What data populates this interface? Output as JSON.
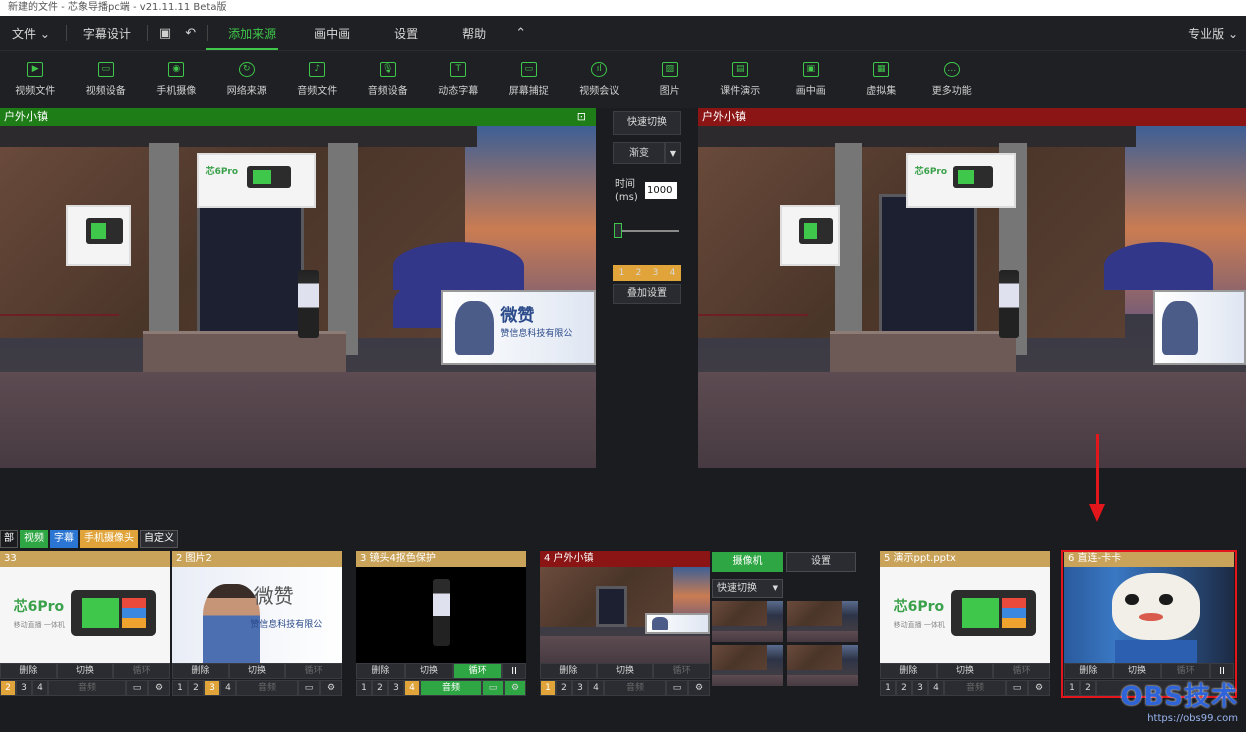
{
  "window": {
    "title": "新建的文件 - 芯象导播pc端 - v21.11.11 Beta版"
  },
  "menu": {
    "file": "文件",
    "file_arrow": "⌄",
    "subtitle_design": "字幕设计",
    "save_icon": "▣",
    "undo_icon": "↶",
    "add_source": "添加来源",
    "pip": "画中画",
    "settings": "设置",
    "help": "帮助",
    "collapse_icon": "⌃",
    "edition": "专业版",
    "edition_arrow": "⌄",
    "accent": "#3ec74a"
  },
  "toolbar": [
    {
      "label": "视频文件",
      "glyph": "▶"
    },
    {
      "label": "视频设备",
      "glyph": "▭"
    },
    {
      "label": "手机摄像",
      "glyph": "◉"
    },
    {
      "label": "网络来源",
      "glyph": "↻"
    },
    {
      "label": "音频文件",
      "glyph": "♪"
    },
    {
      "label": "音频设备",
      "glyph": "🎙"
    },
    {
      "label": "动态字幕",
      "glyph": "T"
    },
    {
      "label": "屏幕捕捉",
      "glyph": "▭"
    },
    {
      "label": "视频会议",
      "glyph": "ıl"
    },
    {
      "label": "图片",
      "glyph": "▨"
    },
    {
      "label": "课件演示",
      "glyph": "▤"
    },
    {
      "label": "画中画",
      "glyph": "▣"
    },
    {
      "label": "虚拟集",
      "glyph": "▦"
    },
    {
      "label": "更多功能",
      "glyph": "…"
    }
  ],
  "preview": {
    "title": "户外小镇",
    "expand_icon": "⊡",
    "color": "#1e7d16"
  },
  "program": {
    "title": "户外小镇",
    "color": "#8b1414"
  },
  "transition": {
    "quick_switch": "快速切换",
    "mode": "渐变",
    "mode_arrow": "▼",
    "time_label_1": "时间",
    "time_label_2": "(ms)",
    "time_value": "1000",
    "overlay_numbers": [
      "1",
      "2",
      "3",
      "4"
    ],
    "overlay_settings": "叠加设置"
  },
  "filter_tabs": [
    "部",
    "视频",
    "字幕",
    "手机摄像头",
    "自定义"
  ],
  "sources": [
    {
      "header": "33",
      "hdcolor": "#c9a35a",
      "type": "phone",
      "brand": "芯6Pro",
      "sub": "移动直播 一体机",
      "r1": [
        "删除",
        "切换",
        "循环"
      ],
      "nums": [
        "2",
        "3",
        "4"
      ],
      "sel": "2",
      "audio": "音频"
    },
    {
      "header": "2 图片2",
      "hdcolor": "#c9a35a",
      "type": "person",
      "brand": "微赞",
      "sub": "赞信息科技有限公",
      "r1": [
        "删除",
        "切换",
        "循环"
      ],
      "nums": [
        "1",
        "2",
        "3",
        "4"
      ],
      "sel": "3",
      "audio": "音频"
    },
    {
      "header": "3 镜头4抠色保护",
      "hdcolor": "#c9a35a",
      "type": "black",
      "r1": [
        "删除",
        "切换",
        "循环",
        "II"
      ],
      "nums": [
        "1",
        "2",
        "3",
        "4"
      ],
      "sel": "4",
      "audio": "音频"
    },
    {
      "header": "4 户外小镇",
      "hdcolor": "#8b1414",
      "type": "scene",
      "r1": [
        "删除",
        "切换",
        "循环"
      ],
      "nums": [
        "1",
        "2",
        "3",
        "4"
      ],
      "sel": "1",
      "audio": "音频"
    },
    {
      "header": "5 演示ppt.pptx",
      "hdcolor": "#c9a35a",
      "type": "phone",
      "brand": "芯6Pro",
      "sub": "移动直播 一体机",
      "r1": [
        "删除",
        "切换",
        "循环"
      ],
      "nums": [
        "1",
        "2",
        "3",
        "4"
      ],
      "sel": "",
      "audio": "音频"
    },
    {
      "header": "6 直连-卡卡",
      "hdcolor": "#c9a35a",
      "type": "mascot",
      "r1": [
        "删除",
        "切换",
        "循环",
        "II"
      ],
      "nums": [
        "1",
        "2"
      ],
      "sel": "",
      "audio": ""
    }
  ],
  "camera": {
    "tab_camera": "摄像机",
    "tab_settings": "设置",
    "quick_switch": "快速切换",
    "arrow": "▼"
  },
  "watermark": {
    "brand": "OBS技术",
    "url": "https://obs99.com"
  }
}
